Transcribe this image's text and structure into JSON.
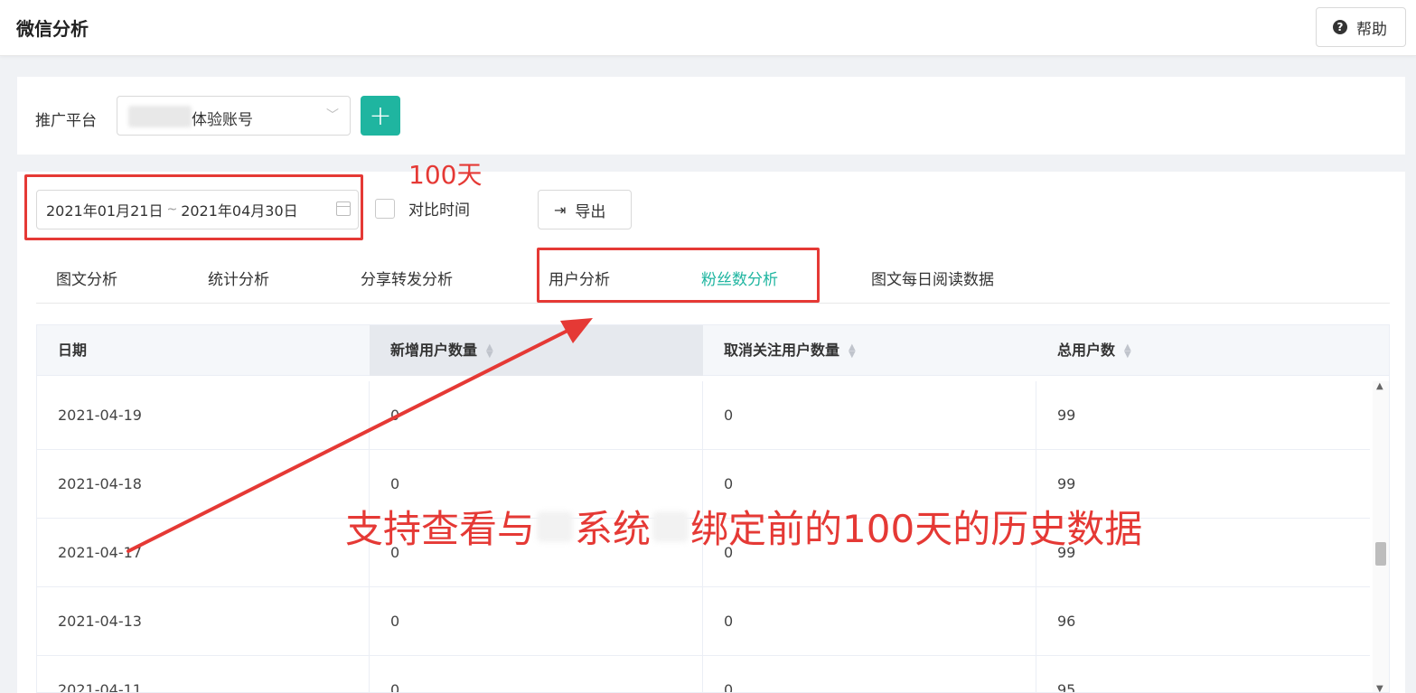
{
  "header": {
    "title": "微信分析",
    "help_label": "帮助",
    "help_icon": "question-circle-icon"
  },
  "platform": {
    "label": "推广平台",
    "selected": "体验账号",
    "add_label": "+"
  },
  "filters": {
    "date_start": "2021年01月21日",
    "date_sep": "~",
    "date_end": "2021年04月30日",
    "compare_label": "对比时间",
    "compare_checked": false,
    "export_label": "导出"
  },
  "tabs": [
    {
      "label": "图文分析",
      "active": false
    },
    {
      "label": "统计分析",
      "active": false
    },
    {
      "label": "分享转发分析",
      "active": false
    },
    {
      "label": "用户分析",
      "active": false
    },
    {
      "label": "粉丝数分析",
      "active": true
    },
    {
      "label": "图文每日阅读数据",
      "active": false
    }
  ],
  "table": {
    "columns": [
      "日期",
      "新增用户数量",
      "取消关注用户数量",
      "总用户数"
    ],
    "rows": [
      [
        "2021-04-19",
        "0",
        "0",
        "99"
      ],
      [
        "2021-04-18",
        "0",
        "0",
        "99"
      ],
      [
        "2021-04-17",
        "0",
        "0",
        "99"
      ],
      [
        "2021-04-13",
        "0",
        "0",
        "96"
      ],
      [
        "2021-04-11",
        "0",
        "0",
        "95"
      ]
    ]
  },
  "annotations": {
    "days_label": "100天",
    "caption_part1": "支持查看与",
    "caption_part2": "系统",
    "caption_part3": "绑定前的100天的历史数据",
    "color": "#e53935"
  }
}
